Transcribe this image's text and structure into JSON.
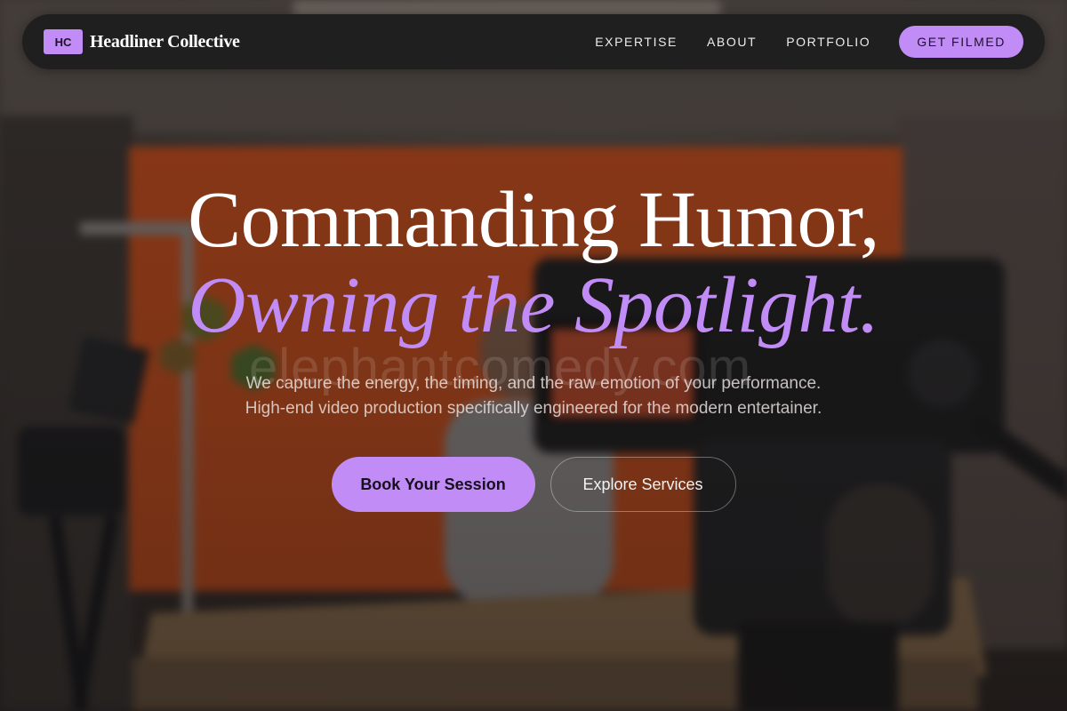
{
  "nav": {
    "badge": "HC",
    "brand": "Headliner Collective",
    "links": [
      "EXPERTISE",
      "ABOUT",
      "PORTFOLIO"
    ],
    "cta": "GET FILMED"
  },
  "hero": {
    "title_line1": "Commanding Humor,",
    "title_line2": "Owning the Spotlight.",
    "subtitle": "We capture the energy, the timing, and the raw emotion of your performance. High-end video production specifically engineered for the modern entertainer.",
    "primary_button": "Book Your Session",
    "secondary_button": "Explore Services",
    "watermark": "elephantcomedy.com"
  },
  "colors": {
    "accent": "#c18cf6",
    "navbar": "#1f1f20",
    "backdrop_wall": "#c8501e"
  }
}
